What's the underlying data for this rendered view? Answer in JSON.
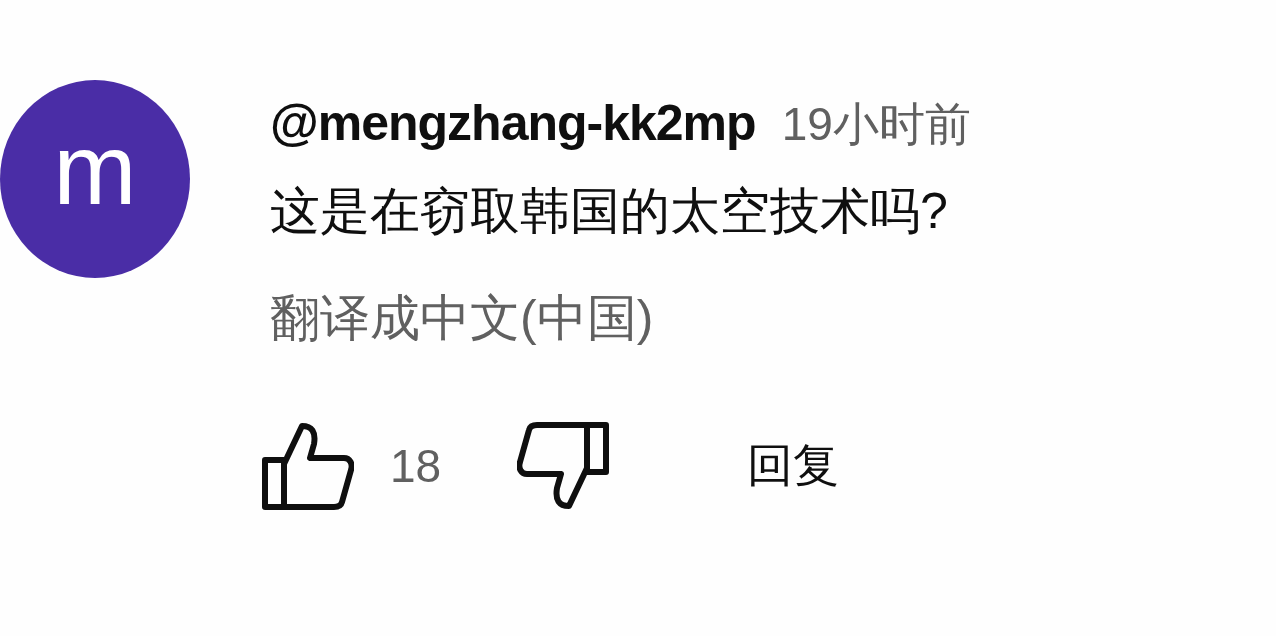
{
  "comment": {
    "avatar_letter": "m",
    "author": "@mengzhang-kk2mp",
    "time": "19小时前",
    "text": "这是在窃取韩国的太空技术吗?",
    "translate_link": "翻译成中文(中国)",
    "actions": {
      "like_count": "18",
      "reply": "回复"
    }
  }
}
